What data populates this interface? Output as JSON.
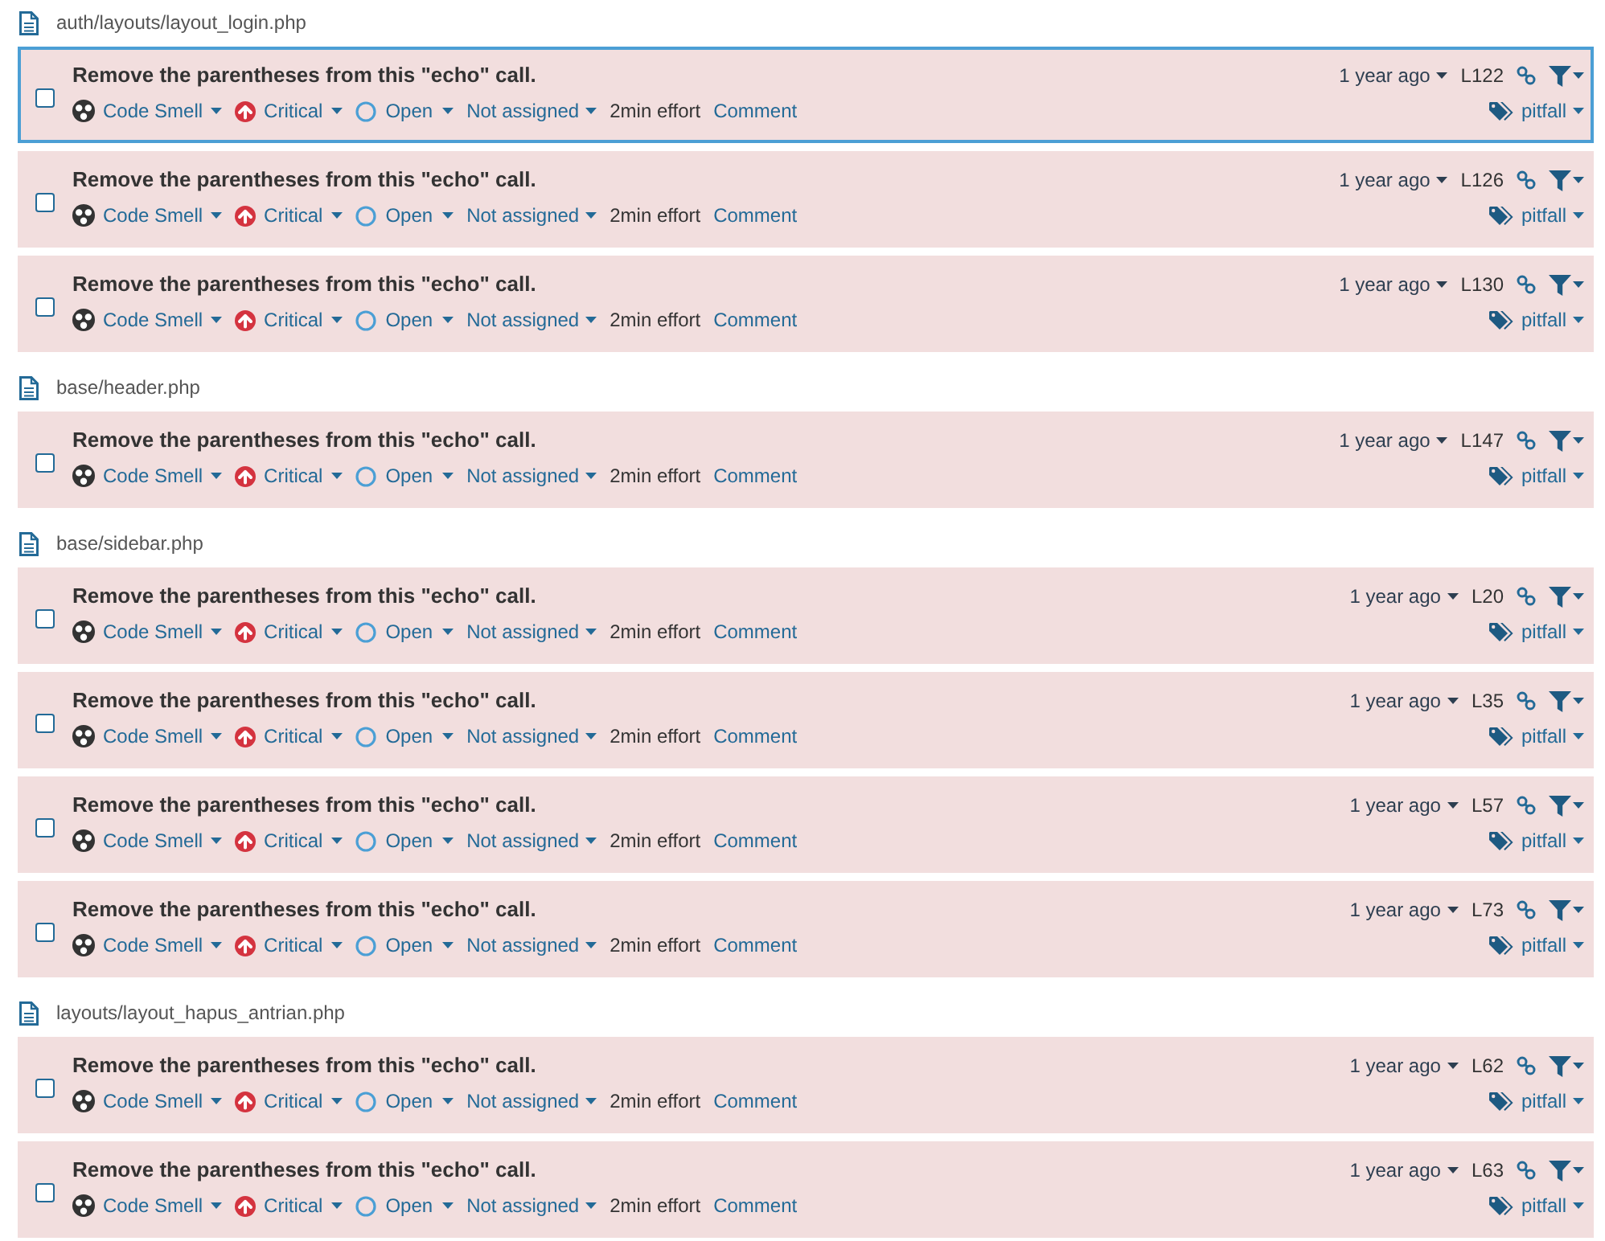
{
  "groups": [
    {
      "file": "auth/layouts/layout_login.php",
      "issues": [
        {
          "message": "Remove the parentheses from this \"echo\" call.",
          "type": "Code Smell",
          "severity": "Critical",
          "status": "Open",
          "assignee": "Not assigned",
          "effort": "2min effort",
          "comment": "Comment",
          "age": "1 year ago",
          "line": "L122",
          "tags": [
            "pitfall"
          ],
          "selected": true,
          "checked": false
        },
        {
          "message": "Remove the parentheses from this \"echo\" call.",
          "type": "Code Smell",
          "severity": "Critical",
          "status": "Open",
          "assignee": "Not assigned",
          "effort": "2min effort",
          "comment": "Comment",
          "age": "1 year ago",
          "line": "L126",
          "tags": [
            "pitfall"
          ],
          "selected": false,
          "checked": false
        },
        {
          "message": "Remove the parentheses from this \"echo\" call.",
          "type": "Code Smell",
          "severity": "Critical",
          "status": "Open",
          "assignee": "Not assigned",
          "effort": "2min effort",
          "comment": "Comment",
          "age": "1 year ago",
          "line": "L130",
          "tags": [
            "pitfall"
          ],
          "selected": false,
          "checked": false
        }
      ]
    },
    {
      "file": "base/header.php",
      "issues": [
        {
          "message": "Remove the parentheses from this \"echo\" call.",
          "type": "Code Smell",
          "severity": "Critical",
          "status": "Open",
          "assignee": "Not assigned",
          "effort": "2min effort",
          "comment": "Comment",
          "age": "1 year ago",
          "line": "L147",
          "tags": [
            "pitfall"
          ],
          "selected": false,
          "checked": false
        }
      ]
    },
    {
      "file": "base/sidebar.php",
      "issues": [
        {
          "message": "Remove the parentheses from this \"echo\" call.",
          "type": "Code Smell",
          "severity": "Critical",
          "status": "Open",
          "assignee": "Not assigned",
          "effort": "2min effort",
          "comment": "Comment",
          "age": "1 year ago",
          "line": "L20",
          "tags": [
            "pitfall"
          ],
          "selected": false,
          "checked": false
        },
        {
          "message": "Remove the parentheses from this \"echo\" call.",
          "type": "Code Smell",
          "severity": "Critical",
          "status": "Open",
          "assignee": "Not assigned",
          "effort": "2min effort",
          "comment": "Comment",
          "age": "1 year ago",
          "line": "L35",
          "tags": [
            "pitfall"
          ],
          "selected": false,
          "checked": false
        },
        {
          "message": "Remove the parentheses from this \"echo\" call.",
          "type": "Code Smell",
          "severity": "Critical",
          "status": "Open",
          "assignee": "Not assigned",
          "effort": "2min effort",
          "comment": "Comment",
          "age": "1 year ago",
          "line": "L57",
          "tags": [
            "pitfall"
          ],
          "selected": false,
          "checked": false
        },
        {
          "message": "Remove the parentheses from this \"echo\" call.",
          "type": "Code Smell",
          "severity": "Critical",
          "status": "Open",
          "assignee": "Not assigned",
          "effort": "2min effort",
          "comment": "Comment",
          "age": "1 year ago",
          "line": "L73",
          "tags": [
            "pitfall"
          ],
          "selected": false,
          "checked": false
        }
      ]
    },
    {
      "file": "layouts/layout_hapus_antrian.php",
      "issues": [
        {
          "message": "Remove the parentheses from this \"echo\" call.",
          "type": "Code Smell",
          "severity": "Critical",
          "status": "Open",
          "assignee": "Not assigned",
          "effort": "2min effort",
          "comment": "Comment",
          "age": "1 year ago",
          "line": "L62",
          "tags": [
            "pitfall"
          ],
          "selected": false,
          "checked": false
        },
        {
          "message": "Remove the parentheses from this \"echo\" call.",
          "type": "Code Smell",
          "severity": "Critical",
          "status": "Open",
          "assignee": "Not assigned",
          "effort": "2min effort",
          "comment": "Comment",
          "age": "1 year ago",
          "line": "L63",
          "tags": [
            "pitfall"
          ],
          "selected": false,
          "checked": false
        }
      ]
    }
  ]
}
